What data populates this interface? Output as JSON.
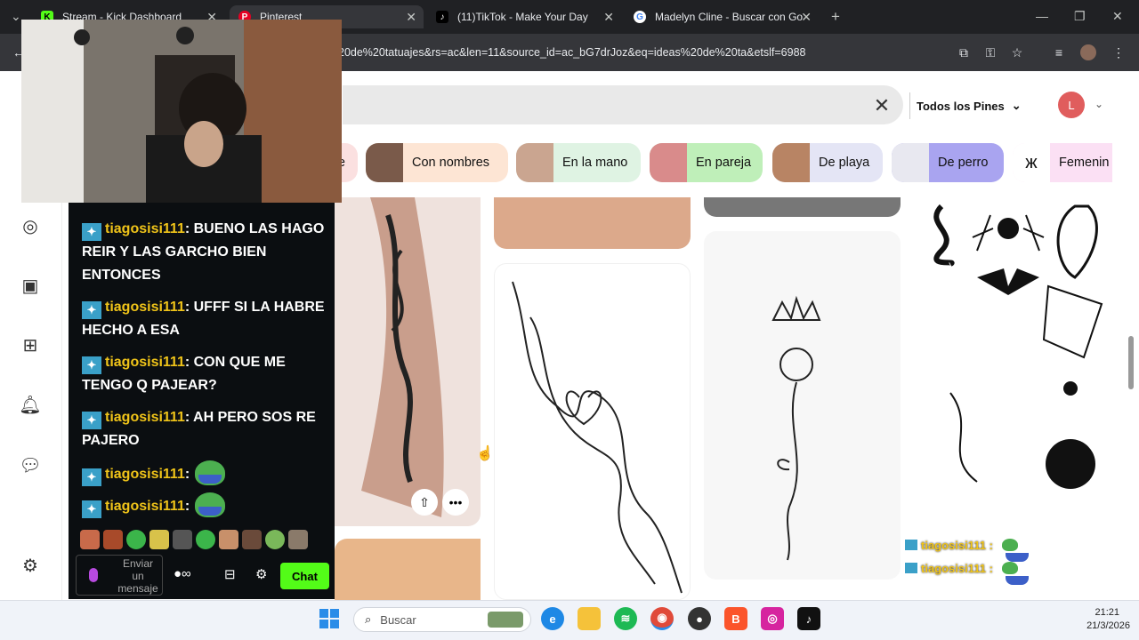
{
  "browser": {
    "tabs": [
      {
        "title": "Stream - Kick Dashboard",
        "icon": "kick-icon",
        "color": "#53fc18"
      },
      {
        "title": "Pinterest",
        "icon": "pinterest-icon",
        "color": "#e60023"
      },
      {
        "title": "(11)TikTok - Make Your Day",
        "icon": "tiktok-icon",
        "color": "#ffffff"
      },
      {
        "title": "Madelyn Cline - Buscar con Go",
        "icon": "google-icon",
        "color": "#4285f4"
      }
    ],
    "new_tab": "+",
    "url": "20de%20tatuajes&rs=ac&len=11&source_id=ac_bG7drJoz&eq=ideas%20de%20ta&etslf=6988"
  },
  "pinterest": {
    "search_clear": "✕",
    "filter_label": "Todos los Pines",
    "avatar_letter": "L",
    "chips": [
      {
        "label": "e",
        "bg": "#fbe0e0"
      },
      {
        "label": "Con nombres",
        "bg": "#fde5d4"
      },
      {
        "label": "En la mano",
        "bg": "#dff3e3"
      },
      {
        "label": "En pareja",
        "bg": "#bfefb9"
      },
      {
        "label": "De playa",
        "bg": "#e4e5f5"
      },
      {
        "label": "De perro",
        "bg": "#a9a4f0"
      },
      {
        "label": "Femenin",
        "bg": "#fbe0f4"
      }
    ]
  },
  "chat": {
    "messages": [
      {
        "user": "tiagosisi111",
        "text": "BUENO LAS HAGO REIR Y LAS GARCHO BIEN ENTONCES"
      },
      {
        "user": "tiagosisi111",
        "text": "UFFF SI LA HABRE HECHO A ESA"
      },
      {
        "user": "tiagosisi111",
        "text": "CON QUE ME TENGO Q PAJEAR?"
      },
      {
        "user": "tiagosisi111",
        "text": "AH PERO SOS RE PAJERO"
      },
      {
        "user": "tiagosisi111",
        "text": ""
      },
      {
        "user": "tiagosisi111",
        "text": ""
      }
    ],
    "input_placeholder": "Enviar un mensaje",
    "chat_button": "Chat",
    "overlay": [
      {
        "user": "tiagosisi111 :"
      },
      {
        "user": "tiagosisi111 :"
      }
    ]
  },
  "taskbar": {
    "search_placeholder": "Buscar",
    "time": "21:21",
    "date": "21/3/2026"
  }
}
